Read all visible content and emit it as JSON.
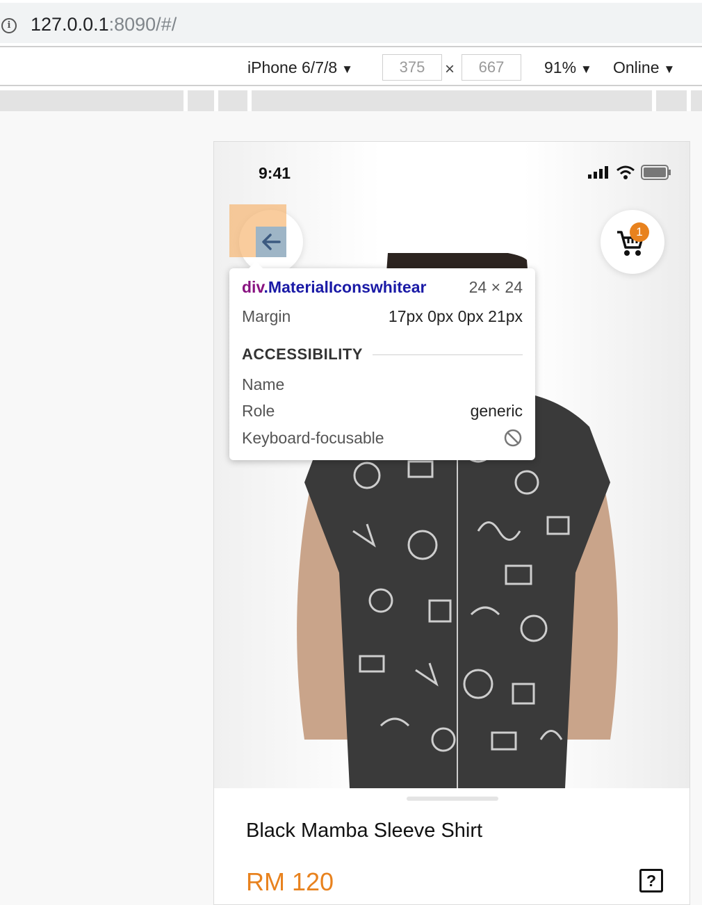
{
  "browser": {
    "url_host": "127.0.0.1",
    "url_path": ":8090/#/"
  },
  "device_toolbar": {
    "device": "iPhone 6/7/8",
    "width": "375",
    "height": "667",
    "times": "×",
    "zoom": "91%",
    "network": "Online"
  },
  "status_bar": {
    "time": "9:41"
  },
  "cart": {
    "count": "1"
  },
  "inspector": {
    "tag": "div",
    "class_name": ".MaterialIconswhitear",
    "size": "24 × 24",
    "margin_label": "Margin",
    "margin_value": "17px 0px 0px 21px",
    "accessibility_heading": "ACCESSIBILITY",
    "name_label": "Name",
    "role_label": "Role",
    "role_value": "generic",
    "focusable_label": "Keyboard-focusable"
  },
  "product": {
    "name": "Black Mamba Sleeve Shirt",
    "price": "RM 120",
    "help_glyph": "?"
  },
  "colors": {
    "accent": "#e8821e",
    "highlight_margin": "#f6b26b",
    "highlight_content": "#6fa8dc"
  }
}
